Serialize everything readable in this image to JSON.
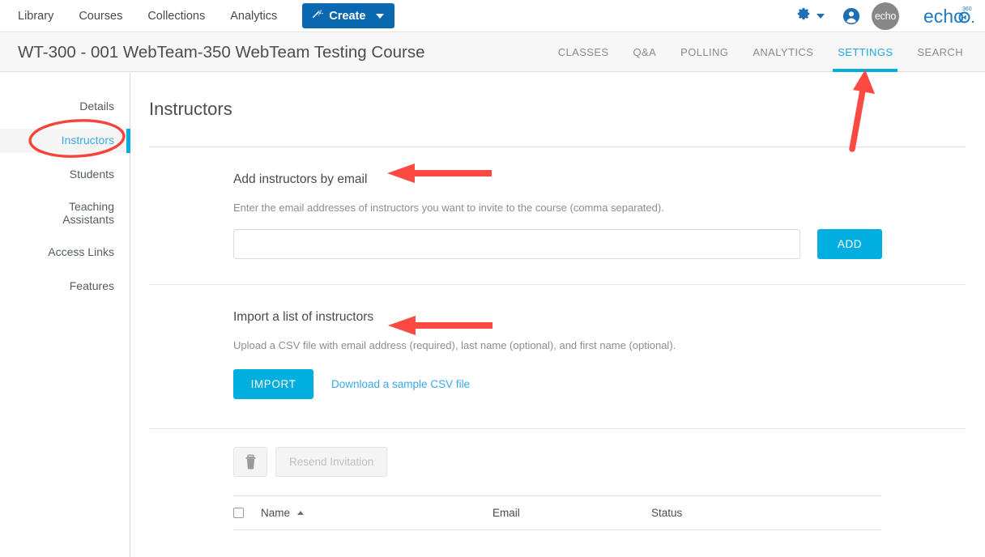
{
  "topnav": {
    "links": [
      "Library",
      "Courses",
      "Collections",
      "Analytics"
    ],
    "create_label": "Create",
    "wand_icon": "magic-wand-icon",
    "gear_icon": "gear-icon",
    "account_icon": "person-icon",
    "avatar_text": "echo",
    "brand_text": "echo",
    "brand_sup": "360",
    "accent_blue": "#0a68b0",
    "accent_cyan": "#00aee0"
  },
  "course": {
    "title": "WT-300 - 001 WebTeam-350 WebTeam Testing Course",
    "tabs": [
      {
        "label": "CLASSES",
        "active": false
      },
      {
        "label": "Q&A",
        "active": false
      },
      {
        "label": "POLLING",
        "active": false
      },
      {
        "label": "ANALYTICS",
        "active": false
      },
      {
        "label": "SETTINGS",
        "active": true
      },
      {
        "label": "SEARCH",
        "active": false
      }
    ]
  },
  "sidebar": {
    "items": [
      {
        "label": "Details",
        "active": false
      },
      {
        "label": "Instructors",
        "active": true
      },
      {
        "label": "Students",
        "active": false
      },
      {
        "label": "Teaching Assistants",
        "active": false
      },
      {
        "label": "Access Links",
        "active": false
      },
      {
        "label": "Features",
        "active": false
      }
    ]
  },
  "main": {
    "page_title": "Instructors",
    "add_section": {
      "heading": "Add instructors by email",
      "description": "Enter the email addresses of instructors you want to invite to the course (comma separated).",
      "input_value": "",
      "input_placeholder": "",
      "button_label": "ADD"
    },
    "import_section": {
      "heading": "Import a list of instructors",
      "description": "Upload a CSV file with email address (required), last name (optional), and first name (optional).",
      "button_label": "IMPORT",
      "link_label": "Download a sample CSV file"
    },
    "table_tools": {
      "delete_icon": "trash-icon",
      "resend_label": "Resend Invitation",
      "resend_disabled": true
    },
    "table": {
      "select_all_checked": false,
      "columns": [
        {
          "label": "Name",
          "sort": "asc"
        },
        {
          "label": "Email",
          "sort": ""
        },
        {
          "label": "Status",
          "sort": ""
        }
      ],
      "rows": []
    }
  },
  "annotations": {
    "color": "#fc4a43",
    "ellipse_target": "Instructors",
    "arrow_1_target": "SETTINGS",
    "arrow_2_target": "Add instructors by email",
    "arrow_3_target": "Import a list of instructors"
  }
}
